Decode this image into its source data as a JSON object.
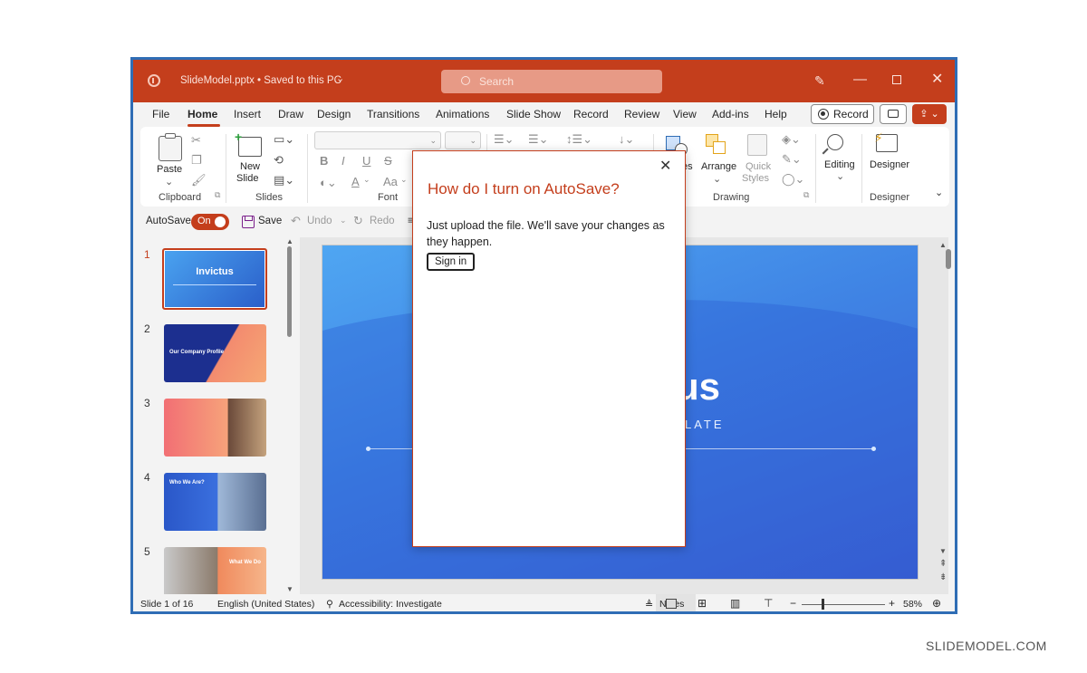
{
  "titlebar": {
    "file_name": "SlideModel.pptx",
    "save_status": "•  Saved to this PC",
    "search_placeholder": "Search"
  },
  "tabs": [
    "File",
    "Home",
    "Insert",
    "Draw",
    "Design",
    "Transitions",
    "Animations",
    "Slide Show",
    "Record",
    "Review",
    "View",
    "Add-ins",
    "Help"
  ],
  "active_tab": "Home",
  "header_buttons": {
    "record": "Record"
  },
  "ribbon": {
    "paste": "Paste",
    "new_slide_line1": "New",
    "new_slide_line2": "Slide",
    "groups": [
      "Clipboard",
      "Slides",
      "Font",
      "Drawing",
      "Designer"
    ],
    "arrange": "Arrange",
    "quick_styles_line1": "Quick",
    "quick_styles_line2": "Styles",
    "shapes_partial": "es",
    "editing": "Editing",
    "designer": "Designer",
    "font_glyphs": [
      "B",
      "I",
      "U",
      "S",
      "A",
      "Aa"
    ]
  },
  "quick_access": {
    "autosave_label": "AutoSave",
    "toggle_state": "On",
    "save": "Save",
    "undo": "Undo",
    "redo": "Redo"
  },
  "thumbnails": [
    {
      "number": "1",
      "title": "Invictus",
      "selected": true
    },
    {
      "number": "2",
      "title": "Our Company Profile"
    },
    {
      "number": "3",
      "title": ""
    },
    {
      "number": "4",
      "title": "Who We Are?"
    },
    {
      "number": "5",
      "title": "What We Do"
    }
  ],
  "slide": {
    "title_partial": "us",
    "subtitle_partial": "LATE"
  },
  "statusbar": {
    "slide_count": "Slide 1 of 16",
    "language": "English (United States)",
    "accessibility": "Accessibility: Investigate",
    "notes": "Notes",
    "zoom_minus": "−",
    "zoom_plus": "+",
    "zoom": "58%"
  },
  "popup": {
    "title": "How do I turn on AutoSave?",
    "body": "Just upload the file. We'll save your changes as they happen.",
    "button": "Sign in"
  },
  "watermark": "SLIDEMODEL.COM",
  "colors": {
    "accent": "#c43e1c",
    "window_border": "#2f6db5",
    "slide_blue": "#3f83e4"
  }
}
